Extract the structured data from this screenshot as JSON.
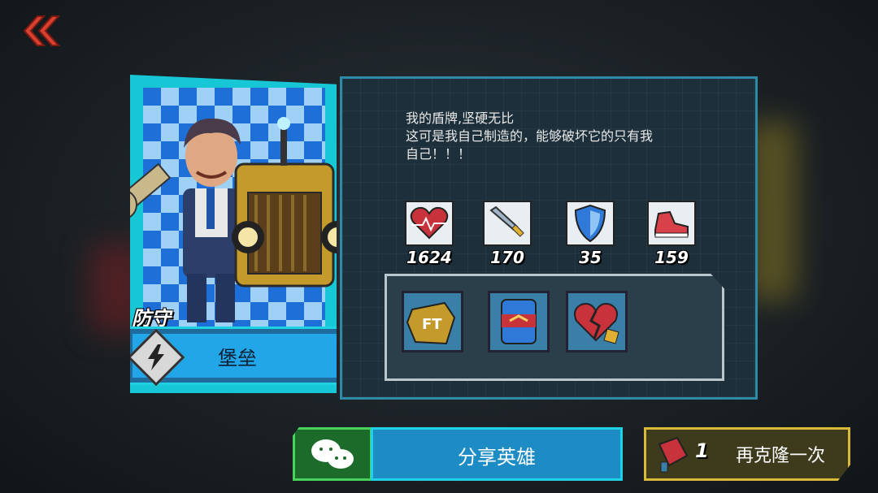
{
  "hero": {
    "role": "防守",
    "class_name": "堡垒",
    "class_icon": "lightning-icon"
  },
  "description": {
    "line1": "我的盾牌,坚硬无比",
    "line2": "这可是我自己制造的，能够破坏它的只有我",
    "line3": "自己！！！"
  },
  "stats": {
    "health": "1624",
    "attack": "170",
    "defense": "35",
    "speed": "159"
  },
  "items": [
    "ft-badge-icon",
    "shield-can-icon",
    "broken-heart-icon"
  ],
  "buttons": {
    "share_label": "分享英雄",
    "clone_count": "1",
    "clone_label": "再克隆一次"
  },
  "colors": {
    "accent_cyan": "#1ed2e4",
    "panel_bg": "#1c2f3a",
    "share_green": "#49d35d",
    "clone_gold": "#d8b93a"
  }
}
